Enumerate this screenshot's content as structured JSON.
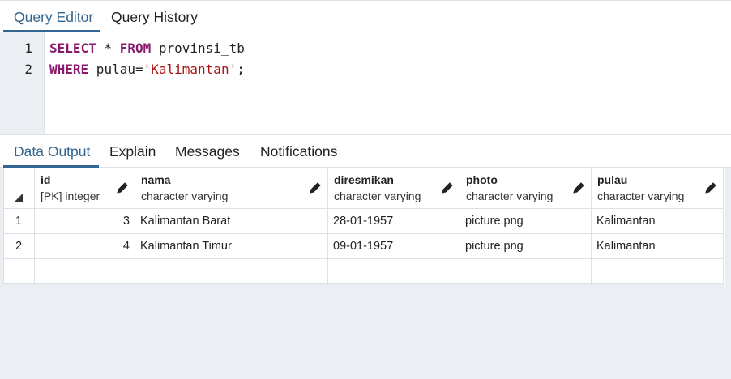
{
  "editor_tabs": [
    {
      "label": "Query Editor",
      "active": true
    },
    {
      "label": "Query History",
      "active": false
    }
  ],
  "editor": {
    "lines": [
      {
        "no": "1",
        "parts": [
          {
            "t": "SELECT",
            "c": "kw"
          },
          {
            "t": " * ",
            "c": ""
          },
          {
            "t": "FROM",
            "c": "kw"
          },
          {
            "t": " provinsi_tb",
            "c": ""
          }
        ]
      },
      {
        "no": "2",
        "parts": [
          {
            "t": "WHERE",
            "c": "kw"
          },
          {
            "t": " pulau=",
            "c": ""
          },
          {
            "t": "'Kalimantan'",
            "c": "str"
          },
          {
            "t": ";",
            "c": ""
          }
        ]
      }
    ]
  },
  "output_tabs": [
    {
      "label": "Data Output",
      "active": true
    },
    {
      "label": "Explain",
      "active": false
    },
    {
      "label": "Messages",
      "active": false
    },
    {
      "label": "Notifications",
      "active": false
    }
  ],
  "grid": {
    "columns": [
      {
        "name": "id",
        "type": "[PK] integer",
        "icon": "pencil-icon"
      },
      {
        "name": "nama",
        "type": "character varying",
        "icon": "pencil-icon"
      },
      {
        "name": "diresmikan",
        "type": "character varying",
        "icon": "pencil-icon"
      },
      {
        "name": "photo",
        "type": "character varying",
        "icon": "pencil-icon"
      },
      {
        "name": "pulau",
        "type": "character varying",
        "icon": "pencil-icon"
      }
    ],
    "rows": [
      {
        "row_no": "1",
        "cells": [
          "3",
          "Kalimantan Barat",
          "28-01-1957",
          "picture.png",
          "Kalimantan"
        ]
      },
      {
        "row_no": "2",
        "cells": [
          "4",
          "Kalimantan Timur",
          "09-01-1957",
          "picture.png",
          "Kalimantan"
        ]
      }
    ]
  },
  "colors": {
    "accent": "#326690",
    "keyword": "#8a1a6e",
    "string": "#aa1111",
    "border": "#dde0e6",
    "panel_bg": "#ebeef3"
  }
}
